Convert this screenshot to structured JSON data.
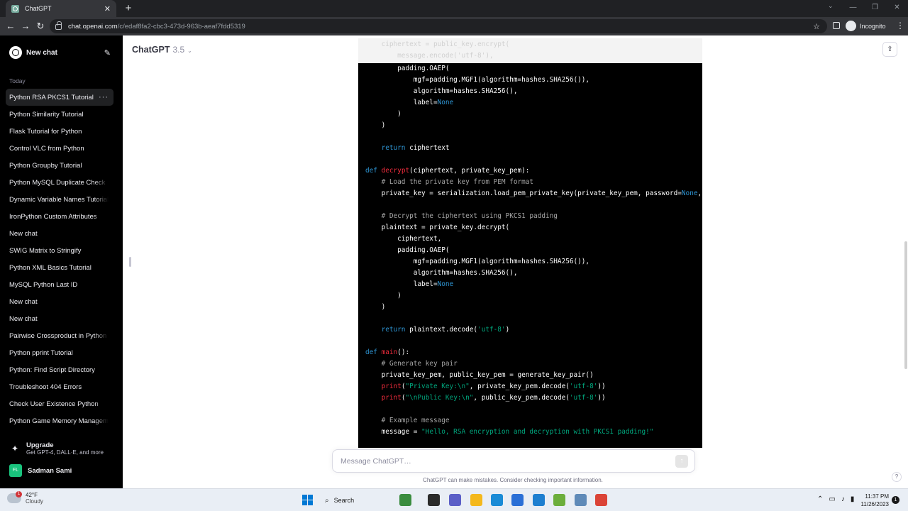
{
  "browser": {
    "tab_title": "ChatGPT",
    "tab_close": "✕",
    "new_tab": "+",
    "url_host": "chat.openai.com",
    "url_path": "/c/edaf8fa2-cbc3-473d-963b-aeaf7fdd5319",
    "incognito_label": "Incognito"
  },
  "sidebar": {
    "new_chat_label": "New chat",
    "section_label": "Today",
    "items": [
      {
        "label": "Python RSA PKCS1 Tutorial",
        "active": true
      },
      {
        "label": "Python Similarity Tutorial"
      },
      {
        "label": "Flask Tutorial for Python"
      },
      {
        "label": "Control VLC from Python"
      },
      {
        "label": "Python Groupby Tutorial"
      },
      {
        "label": "Python MySQL Duplicate Check"
      },
      {
        "label": "Dynamic Variable Names Tutorial"
      },
      {
        "label": "IronPython Custom Attributes"
      },
      {
        "label": "New chat"
      },
      {
        "label": "SWIG Matrix to Stringify"
      },
      {
        "label": "Python XML Basics Tutorial"
      },
      {
        "label": "MySQL Python Last ID"
      },
      {
        "label": "New chat"
      },
      {
        "label": "New chat"
      },
      {
        "label": "Pairwise Crossproduct in Python"
      },
      {
        "label": "Python pprint Tutorial"
      },
      {
        "label": "Python: Find Script Directory"
      },
      {
        "label": "Troubleshoot 404 Errors"
      },
      {
        "label": "Check User Existence Python"
      },
      {
        "label": "Python Game Memory Management"
      }
    ],
    "more_label": "···",
    "upgrade_title": "Upgrade",
    "upgrade_sub": "Get GPT-4, DALL·E, and more",
    "user_initials": "FL",
    "user_name": "Sadman Sami"
  },
  "main": {
    "model_name": "ChatGPT",
    "model_version": "3.5",
    "composer_placeholder": "Message ChatGPT…",
    "disclaimer": "ChatGPT can make mistakes. Consider checking important information.",
    "help": "?"
  },
  "code": {
    "faded_lines": [
      "    ciphertext = public_key.encrypt(",
      "        message.encode('utf-8'),"
    ],
    "lines": [
      [
        {
          "t": "        padding.OAEP("
        }
      ],
      [
        {
          "t": "            mgf=padding.MGF1(algorithm=hashes.SHA256()),"
        }
      ],
      [
        {
          "t": "            algorithm=hashes.SHA256(),"
        }
      ],
      [
        {
          "t": "            label="
        },
        {
          "t": "None",
          "c": "nn"
        }
      ],
      [
        {
          "t": "        )"
        }
      ],
      [
        {
          "t": "    )"
        }
      ],
      [
        {
          "t": ""
        }
      ],
      [
        {
          "t": "    return",
          "c": "kw"
        },
        {
          "t": " ciphertext"
        }
      ],
      [
        {
          "t": ""
        }
      ],
      [
        {
          "t": "def",
          "c": "kw"
        },
        {
          "t": " "
        },
        {
          "t": "decrypt",
          "c": "fn"
        },
        {
          "t": "(ciphertext, private_key_pem):"
        }
      ],
      [
        {
          "t": "    "
        },
        {
          "t": "# Load the private key from PEM format",
          "c": "cm"
        }
      ],
      [
        {
          "t": "    private_key = serialization.load_pem_private_key(private_key_pem, password="
        },
        {
          "t": "None",
          "c": "nn"
        },
        {
          "t": ", "
        }
      ],
      [
        {
          "t": ""
        }
      ],
      [
        {
          "t": "    "
        },
        {
          "t": "# Decrypt the ciphertext using PKCS1 padding",
          "c": "cm"
        }
      ],
      [
        {
          "t": "    plaintext = private_key.decrypt("
        }
      ],
      [
        {
          "t": "        ciphertext,"
        }
      ],
      [
        {
          "t": "        padding.OAEP("
        }
      ],
      [
        {
          "t": "            mgf=padding.MGF1(algorithm=hashes.SHA256()),"
        }
      ],
      [
        {
          "t": "            algorithm=hashes.SHA256(),"
        }
      ],
      [
        {
          "t": "            label="
        },
        {
          "t": "None",
          "c": "nn"
        }
      ],
      [
        {
          "t": "        )"
        }
      ],
      [
        {
          "t": "    )"
        }
      ],
      [
        {
          "t": ""
        }
      ],
      [
        {
          "t": "    return",
          "c": "kw"
        },
        {
          "t": " plaintext.decode("
        },
        {
          "t": "'utf-8'",
          "c": "str"
        },
        {
          "t": ")"
        }
      ],
      [
        {
          "t": ""
        }
      ],
      [
        {
          "t": "def",
          "c": "kw"
        },
        {
          "t": " "
        },
        {
          "t": "main",
          "c": "fn"
        },
        {
          "t": "():"
        }
      ],
      [
        {
          "t": "    "
        },
        {
          "t": "# Generate key pair",
          "c": "cm"
        }
      ],
      [
        {
          "t": "    private_key_pem, public_key_pem = generate_key_pair()"
        }
      ],
      [
        {
          "t": "    "
        },
        {
          "t": "print",
          "c": "fn"
        },
        {
          "t": "("
        },
        {
          "t": "\"Private Key:\\n\"",
          "c": "str"
        },
        {
          "t": ", private_key_pem.decode("
        },
        {
          "t": "'utf-8'",
          "c": "str"
        },
        {
          "t": "))"
        }
      ],
      [
        {
          "t": "    "
        },
        {
          "t": "print",
          "c": "fn"
        },
        {
          "t": "("
        },
        {
          "t": "\"\\nPublic Key:\\n\"",
          "c": "str"
        },
        {
          "t": ", public_key_pem.decode("
        },
        {
          "t": "'utf-8'",
          "c": "str"
        },
        {
          "t": "))"
        }
      ],
      [
        {
          "t": ""
        }
      ],
      [
        {
          "t": "    "
        },
        {
          "t": "# Example message",
          "c": "cm"
        }
      ],
      [
        {
          "t": "    message = "
        },
        {
          "t": "\"Hello, RSA encryption and decryption with PKCS1 padding!\"",
          "c": "str"
        }
      ],
      [
        {
          "t": ""
        }
      ]
    ]
  },
  "taskbar": {
    "weather_temp": "42°F",
    "weather_cond": "Cloudy",
    "weather_badge": "1",
    "search_label": "Search",
    "time": "11:37 PM",
    "date": "11/26/2023",
    "notif_count": "1",
    "apps": [
      {
        "name": "tree-app-icon",
        "color": "#3a8c3f"
      },
      {
        "name": "task-view-icon",
        "color": "#2b2b2b"
      },
      {
        "name": "teams-chat-icon",
        "color": "#5b5fc7"
      },
      {
        "name": "file-explorer-icon",
        "color": "#f4b81c"
      },
      {
        "name": "edge-icon",
        "color": "#1a8bd6"
      },
      {
        "name": "store-icon",
        "color": "#2a6fd6"
      },
      {
        "name": "vscode-icon",
        "color": "#1e7fd0"
      },
      {
        "name": "notepad-icon",
        "color": "#6cae3c"
      },
      {
        "name": "remote-desktop-icon",
        "color": "#5f8ab8"
      },
      {
        "name": "chrome-icon",
        "color": "#db4437"
      }
    ]
  }
}
